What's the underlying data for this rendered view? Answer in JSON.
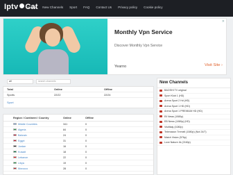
{
  "header": {
    "logo_left": "Iptv",
    "logo_right": "Cat",
    "nav": [
      "Home",
      "New Channels",
      "Sport",
      "FAQ",
      "Contact Us",
      "Privacy policy",
      "Cookie policy"
    ]
  },
  "ad": {
    "title": "Monthly Vpn Service",
    "subtitle": "Discover Monthly Vpn Service",
    "brand": "Yearno",
    "cta": "Visit Site",
    "cta_chevron": "›",
    "close": "✕"
  },
  "search": {
    "value": "all",
    "placeholder": "search channels"
  },
  "stats": {
    "headers": [
      "Total",
      "Online",
      "Offline"
    ],
    "rows": [
      [
        "Sports",
        "22/22",
        "22/24"
      ]
    ],
    "sport_link": "Sport"
  },
  "regions": {
    "headers": [
      "Region / Continent / Country",
      "Online",
      "Offline"
    ],
    "rows": [
      {
        "name": "Middle Countries",
        "online": "341",
        "offline": "0",
        "flag_color": "#7fa8d9"
      },
      {
        "name": "Algeria",
        "online": "84",
        "offline": "0",
        "flag_color": "#2e9a4e"
      },
      {
        "name": "Bahrain",
        "online": "24",
        "offline": "0",
        "flag_color": "#c8102e"
      },
      {
        "name": "Egypt",
        "online": "31",
        "offline": "0",
        "flag_color": "#ce1126"
      },
      {
        "name": "Jordan",
        "online": "16",
        "offline": "0",
        "flag_color": "#333333"
      },
      {
        "name": "Kuwait",
        "online": "18",
        "offline": "0",
        "flag_color": "#007a3d"
      },
      {
        "name": "Lebanon",
        "online": "22",
        "offline": "0",
        "flag_color": "#ed1c24"
      },
      {
        "name": "Libya",
        "online": "19",
        "offline": "0",
        "flag_color": "#239e46"
      },
      {
        "name": "Morocco",
        "online": "28",
        "offline": "0",
        "flag_color": "#c1272d"
      }
    ]
  },
  "sidebar": {
    "title": "New Channels",
    "items": [
      "BAOSHI TV original",
      "Sport Klub 1 (HD)",
      "Arena Sport 2 Hd (HD)",
      "Arena Sport 1 HD (HD)",
      "Arena Sport 1 PREMIUM HD (HD)",
      "Eil News (1080p)",
      "EB News (1080p) (HD)",
      "VisitItaly (1080p)",
      "Telemaxon Tremell (1080p) (Not 24/7)",
      "Match Vision (576p)",
      "Love Nature 4k (2160p)"
    ]
  },
  "colors": {
    "topbar": "#1d1f24",
    "accent_link": "#3c7fc4",
    "cta": "#e0602a"
  }
}
